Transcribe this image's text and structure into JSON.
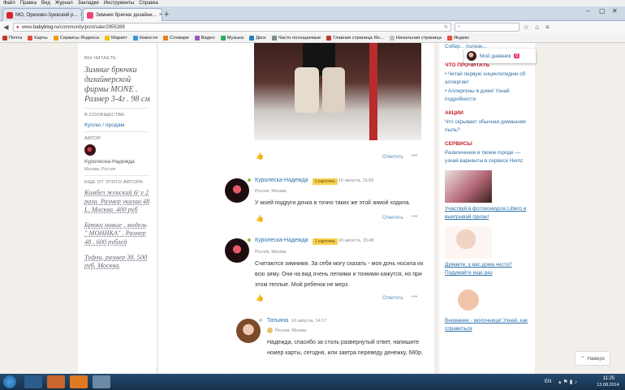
{
  "menubar": [
    "Файл",
    "Правка",
    "Вид",
    "Журнал",
    "Закладки",
    "Инструменты",
    "Справка"
  ],
  "tabs": [
    {
      "label": "МО, Орехово-Зуевский р...",
      "active": false,
      "color": "#d8232a"
    },
    {
      "label": "Зимние брючки дизайне...",
      "active": true,
      "color": "#e8457c"
    }
  ],
  "url": {
    "prefix": "www.",
    "host": "babyblog.ru",
    "path": "/community/post/sale/2955289"
  },
  "bookmarks": [
    {
      "label": "Почта",
      "color": "#c0392b"
    },
    {
      "label": "Карты",
      "color": "#e74c3c"
    },
    {
      "label": "Сервисы Яндекса",
      "color": "#f39c12"
    },
    {
      "label": "Маркет",
      "color": "#f1c40f"
    },
    {
      "label": "Новости",
      "color": "#3498db"
    },
    {
      "label": "Словари",
      "color": "#e67e22"
    },
    {
      "label": "Видео",
      "color": "#9b59b6"
    },
    {
      "label": "Музыка",
      "color": "#27ae60"
    },
    {
      "label": "Диск",
      "color": "#2980b9"
    },
    {
      "label": "Часто посещаемые",
      "color": "#7f8c8d"
    },
    {
      "label": "Главная страница Ян...",
      "color": "#c0392b"
    },
    {
      "label": "Начальная страница",
      "color": "#bdc3c7"
    },
    {
      "label": "Яндекс",
      "color": "#e74c3c"
    }
  ],
  "left": {
    "reading_label": "ВЫ ЧИТАЕТЕ:",
    "reading_title": "Зимние брючки дизайнерской фирмы MONE . Размер 3-4г . 98 см",
    "community_label": "В СООБЩЕСТВЕ:",
    "community_link": "Куплю / продам",
    "author_label": "АВТОР:",
    "author_name": "Куролеска-Надежда",
    "author_location": "Москва, Россия",
    "more_label": "ЕЩЕ ОТ ЭТОГО АВТОРА:",
    "more_posts": [
      "Комбез женский 6/ у 2 раза. Размер указан 48 L. Москва. 400 руб",
      "Брюки новые , модель \" МОНИКА\" . Размер 48 . 600 рублей",
      "Туфли, размер 38. 500 руб. Москва."
    ]
  },
  "comments": [
    {
      "name": "Куролеска-Надежда",
      "badge": "1 карточка",
      "date": "10 августа, 15:50",
      "location": "Россия, Москва",
      "text": "У моей подруги дочка в точно таких же этой зимой ходила.",
      "reply": "Ответить",
      "more": "•••"
    },
    {
      "name": "Куролеска-Надежда",
      "badge": "1 карточка",
      "date": "10 августа, 15:48",
      "location": "Россия, Москва",
      "text": "Считаются зимними. За себя могу сказать - моя дочь носила их всю зиму. Они на вид очень легкими и тонкими кажутся, но при этом теплые. Мой ребенок не мерз.",
      "reply": "Ответить",
      "more": "•••"
    },
    {
      "name": "Татьяна",
      "date": "10 августа, 14:17",
      "location": "Россия, Москва",
      "text": "Надежда, спасибо за столь развернутый ответ, напишите номер карты, сегодня, или завтра переведу денежку, 680р."
    }
  ],
  "post_reply": "Ответить",
  "post_more": "•••",
  "right": {
    "top_link": "Собер... полезн...",
    "popup_label": "Мой дневник",
    "popup_count": "0",
    "what_to_read": "ЧТО ПРОЧИТАТЬ",
    "read_links": [
      "• Читай первую энциклопедию об аллергии!",
      "• Аллергены в доме! Узнай подробности"
    ],
    "actions": "АКЦИИ",
    "action_link": "Что скрывает обычная домашняя пыль?",
    "services": "СЕРВИСЫ",
    "service_link": "Развлечения в твоем городе — узнай варианты в сервисе Heinz",
    "promos": [
      "Участвуй в фотоконкурсе Libero и выигрывай призы!",
      "Думаете, у вас дома чисто? Подумайте еще раз",
      "Внимание - молочница! Узнай, как справиться"
    ]
  },
  "back_to_top": "Наверх",
  "taskbar": {
    "lang": "EN",
    "time": "11:25",
    "date": "13.08.2014"
  }
}
